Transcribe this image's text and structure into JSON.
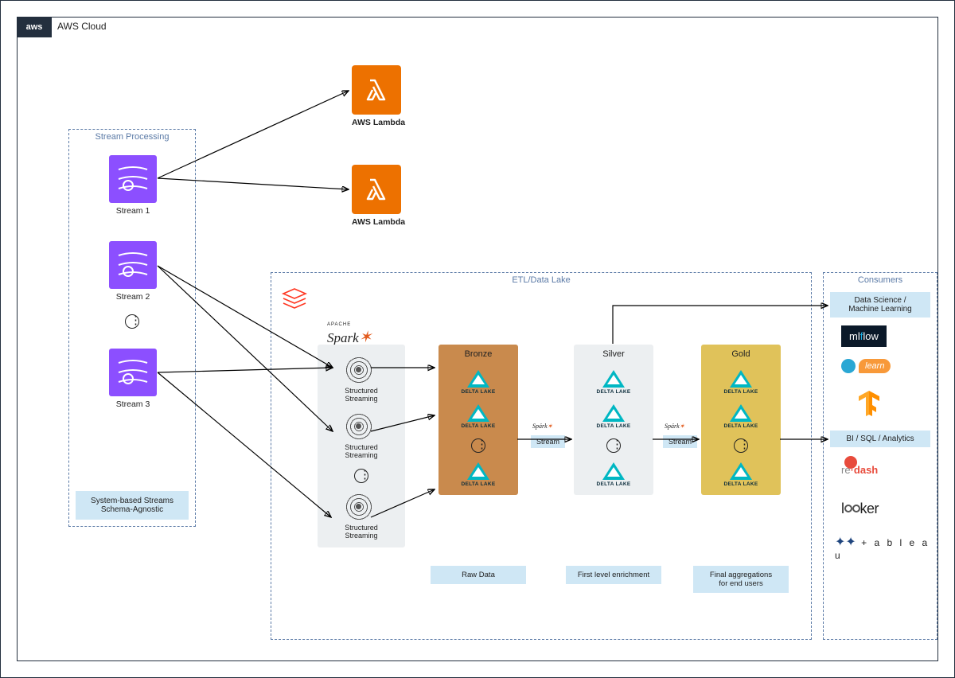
{
  "cloud": {
    "badge": "aws",
    "title": "AWS Cloud"
  },
  "groups": {
    "stream": {
      "title": "Stream Processing",
      "caption": "System-based Streams\nSchema-Agnostic"
    },
    "etl": {
      "title": "ETL/Data Lake"
    },
    "consumers": {
      "title": "Consumers"
    }
  },
  "streams": [
    {
      "label": "Stream 1"
    },
    {
      "label": "Stream 2"
    },
    {
      "label": "Stream 3"
    }
  ],
  "lambda": {
    "label": "AWS Lambda"
  },
  "spark": {
    "brandTop": "APACHE",
    "brand": "Spark"
  },
  "structured": {
    "label": "Structured\nStreaming"
  },
  "stages": {
    "bronze": {
      "title": "Bronze",
      "caption": "Raw Data"
    },
    "silver": {
      "title": "Silver",
      "caption": "First level enrichment"
    },
    "gold": {
      "title": "Gold",
      "caption": "Final aggregations\nfor end users"
    }
  },
  "delta": {
    "label": "DELTA LAKE"
  },
  "streamPill": "Stream",
  "consumers": {
    "ds": "Data Science /\nMachine Learning",
    "bi": "BI / SQL / Analytics",
    "logos": {
      "mlflow": "mlflow",
      "sklearn": "learn",
      "tf": "TF",
      "redash": "re dash",
      "looker": "looker",
      "tableau": "+ a b l e a u"
    }
  }
}
